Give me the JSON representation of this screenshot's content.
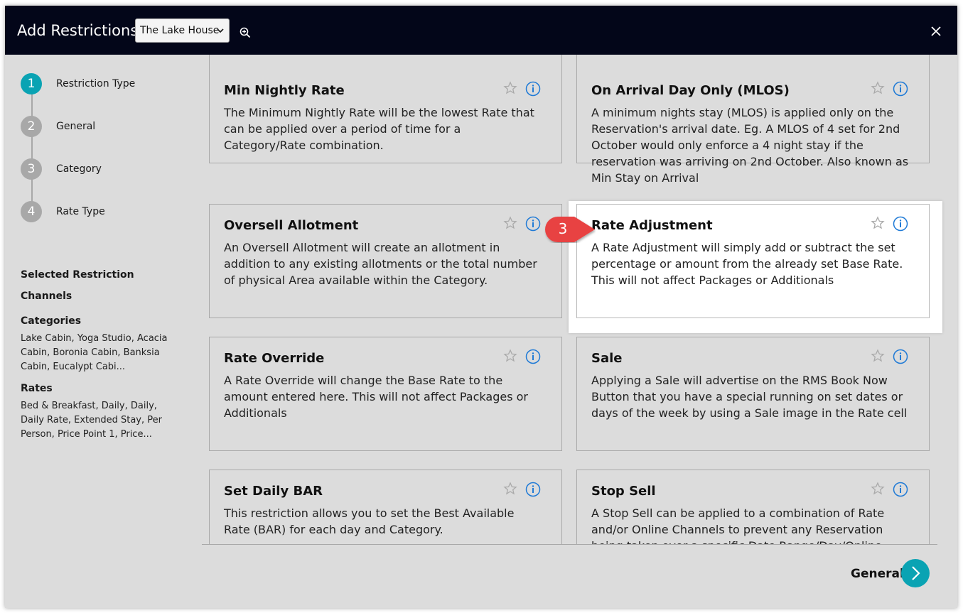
{
  "header": {
    "title": "Add Restrictions",
    "property_value": "The Lake House"
  },
  "steps": [
    {
      "number": "1",
      "label": "Restriction Type",
      "active": true
    },
    {
      "number": "2",
      "label": "General",
      "active": false
    },
    {
      "number": "3",
      "label": "Category",
      "active": false
    },
    {
      "number": "4",
      "label": "Rate Type",
      "active": false
    }
  ],
  "summary": {
    "selected_restriction_label": "Selected Restriction",
    "channels_label": "Channels",
    "categories_label": "Categories",
    "categories_value": "Lake Cabin, Yoga Studio, Acacia Cabin, Boronia Cabin, Banksia Cabin, Eucalypt Cabi...",
    "rates_label": "Rates",
    "rates_value": "Bed & Breakfast, Daily, Daily, Daily Rate, Extended Stay, Per Person, Price Point 1, Price..."
  },
  "cards": [
    {
      "title": "Min Nightly Rate",
      "description": "The Minimum Nightly Rate will be the lowest Rate that can be applied over a period of time for a Category/Rate combination."
    },
    {
      "title": "On Arrival Day Only (MLOS)",
      "description": "A minimum nights stay (MLOS) is applied only on the Reservation's arrival date. Eg. A MLOS of 4 set for 2nd October would only enforce a 4 night stay if the reservation was arriving on 2nd October. Also known as Min Stay on Arrival"
    },
    {
      "title": "Oversell Allotment",
      "description": "An Oversell Allotment will create an allotment in addition to any existing allotments or the total number of physical Area available within the Category."
    },
    {
      "title": "Rate Adjustment",
      "description": "A Rate Adjustment will simply add or subtract the set percentage or amount from the already set Base Rate. This will not affect Packages or Additionals"
    },
    {
      "title": "Rate Override",
      "description": "A Rate Override will change the Base Rate to the amount entered here. This will not affect Packages or Additionals"
    },
    {
      "title": "Sale",
      "description": "Applying a Sale will advertise on the RMS Book Now Button that you have a special running on set dates or days of the week by using a Sale image in the Rate cell"
    },
    {
      "title": "Set Daily BAR",
      "description": "This restriction allows you to set the Best Available Rate (BAR) for each day and Category."
    },
    {
      "title": "Stop Sell",
      "description": "A Stop Sell can be applied to a combination of Rate and/or Online Channels to prevent any Reservation being taken over a specific Date Range/Day/Online Channel combination"
    }
  ],
  "callout": {
    "number": "3"
  },
  "footer": {
    "next_label": "General"
  },
  "colors": {
    "header_bg": "#030619",
    "accent": "#0aa3b3",
    "info_icon": "#1f7ad6",
    "callout": "#e84343"
  },
  "icons": [
    "chevron-down-icon",
    "zoom-icon",
    "close-icon",
    "star-icon",
    "info-icon",
    "arrow-right-icon"
  ]
}
